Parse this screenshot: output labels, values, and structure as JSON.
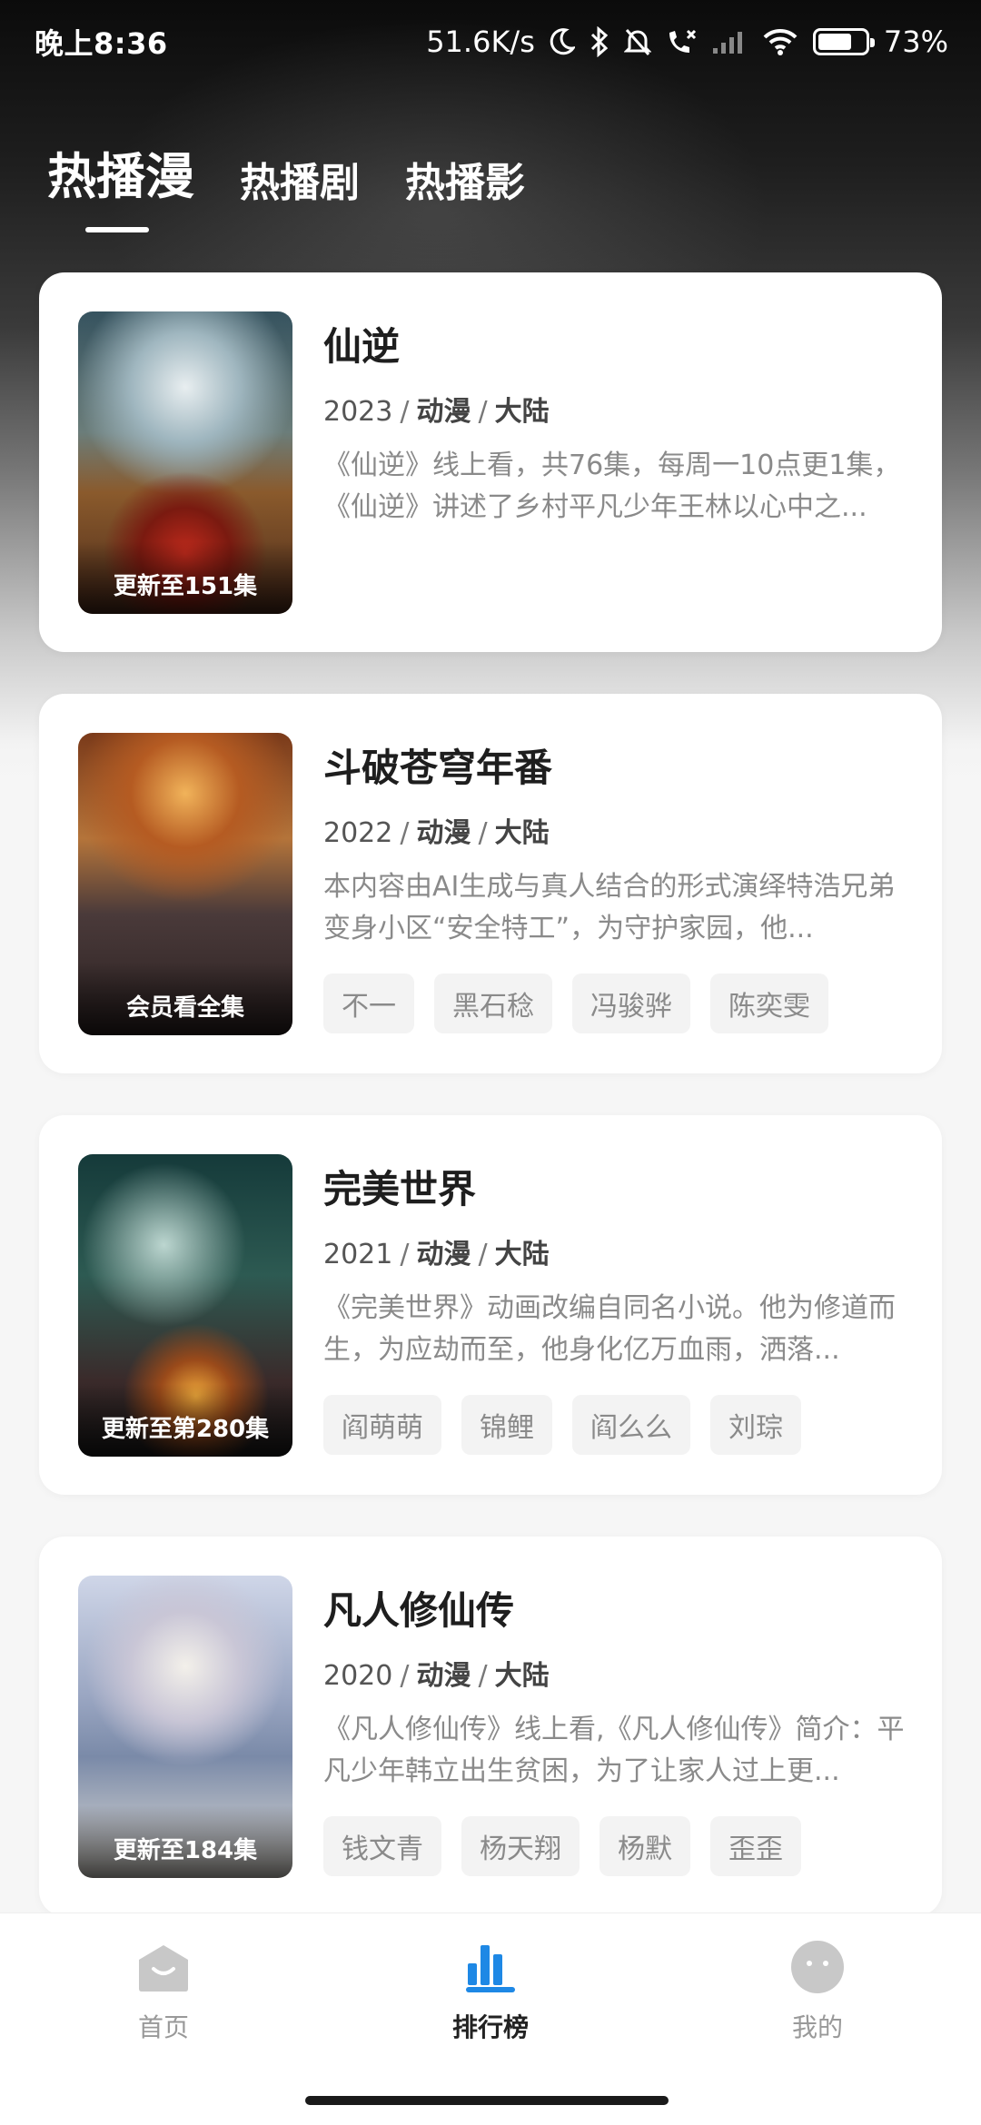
{
  "status_bar": {
    "time": "晚上8:36",
    "net_speed": "51.6K/s",
    "battery_percent": "73%",
    "battery_level": 0.73
  },
  "tabs": [
    {
      "label": "热播漫",
      "active": true
    },
    {
      "label": "热播剧",
      "active": false
    },
    {
      "label": "热播影",
      "active": false
    }
  ],
  "items": [
    {
      "title": "仙逆",
      "year": "2023",
      "type": "动漫",
      "region": "大陆",
      "description": "《仙逆》线上看，共76集，每周一10点更1集，《仙逆》讲述了乡村平凡少年王林以心中之...",
      "badge": "更新至151集",
      "tags": []
    },
    {
      "title": "斗破苍穹年番",
      "year": "2022",
      "type": "动漫",
      "region": "大陆",
      "description": "本内容由AI生成与真人结合的形式演绎特浩兄弟变身小区“安全特工”，为守护家园，他...",
      "badge": "会员看全集",
      "tags": [
        "不一",
        "黑石稔",
        "冯骏骅",
        "陈奕雯"
      ]
    },
    {
      "title": "完美世界",
      "year": "2021",
      "type": "动漫",
      "region": "大陆",
      "description": "《完美世界》动画改编自同名小说。他为修道而生，为应劫而至，他身化亿万血雨，洒落...",
      "badge": "更新至第280集",
      "tags": [
        "阎萌萌",
        "锦鲤",
        "阎么么",
        "刘琮"
      ]
    },
    {
      "title": "凡人修仙传",
      "year": "2020",
      "type": "动漫",
      "region": "大陆",
      "description": "《凡人修仙传》线上看,《凡人修仙传》简介：平凡少年韩立出生贫困，为了让家人过上更...",
      "badge": "更新至184集",
      "tags": [
        "钱文青",
        "杨天翔",
        "杨默",
        "歪歪"
      ]
    }
  ],
  "bottom_nav": [
    {
      "label": "首页",
      "icon": "home-icon",
      "active": false
    },
    {
      "label": "排行榜",
      "icon": "ranking-icon",
      "active": true
    },
    {
      "label": "我的",
      "icon": "profile-icon",
      "active": false
    }
  ],
  "colors": {
    "accent": "#1e88e5",
    "tag_bg": "#f3f3f3",
    "muted_text": "#8a8a8a"
  }
}
